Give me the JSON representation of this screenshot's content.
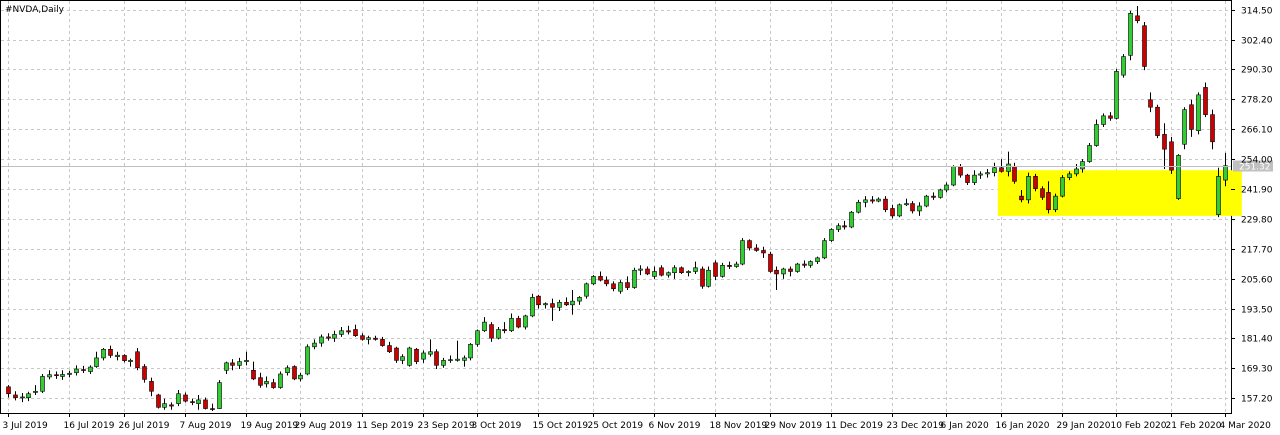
{
  "chart_title": "#NVDA,Daily",
  "current_price_label": "251.32",
  "colors": {
    "bull": "#32cd32",
    "bear": "#cd0000",
    "wick": "#000000",
    "grid": "#c8c8c8",
    "highlight": "#ffff00",
    "price_tag_bg": "#c0c0c0"
  },
  "chart_data": {
    "type": "candlestick",
    "ylim": [
      151.2,
      318.0
    ],
    "grid": true,
    "y_ticks": [
      157.2,
      169.3,
      181.4,
      193.5,
      205.6,
      217.7,
      229.8,
      241.9,
      254.0,
      266.1,
      278.2,
      290.3,
      302.4,
      314.5
    ],
    "y_tick_labels": [
      "157.20",
      "169.30",
      "181.40",
      "193.50",
      "205.60",
      "217.70",
      "229.80",
      "241.90",
      "254.00",
      "266.10",
      "278.20",
      "290.30",
      "302.40",
      "314.50"
    ],
    "x_ticks": [
      {
        "index": 0,
        "label": "3 Jul 2019"
      },
      {
        "index": 9,
        "label": "16 Jul 2019"
      },
      {
        "index": 17,
        "label": "26 Jul 2019"
      },
      {
        "index": 26,
        "label": "7 Aug 2019"
      },
      {
        "index": 35,
        "label": "19 Aug 2019"
      },
      {
        "index": 43,
        "label": "29 Aug 2019"
      },
      {
        "index": 52,
        "label": "11 Sep 2019"
      },
      {
        "index": 61,
        "label": "23 Sep 2019"
      },
      {
        "index": 69,
        "label": "3 Oct 2019"
      },
      {
        "index": 78,
        "label": "15 Oct 2019"
      },
      {
        "index": 86,
        "label": "25 Oct 2019"
      },
      {
        "index": 95,
        "label": "6 Nov 2019"
      },
      {
        "index": 104,
        "label": "18 Nov 2019"
      },
      {
        "index": 112,
        "label": "29 Nov 2019"
      },
      {
        "index": 121,
        "label": "11 Dec 2019"
      },
      {
        "index": 130,
        "label": "23 Dec 2019"
      },
      {
        "index": 138,
        "label": "6 Jan 2020"
      },
      {
        "index": 146,
        "label": "16 Jan 2020"
      },
      {
        "index": 155,
        "label": "29 Jan 2020"
      },
      {
        "index": 163,
        "label": "10 Feb 2020"
      },
      {
        "index": 171,
        "label": "21 Feb 2020"
      },
      {
        "index": 179,
        "label": "4 Mar 2020"
      }
    ],
    "current_price": 251.32,
    "highlight_zone": {
      "start_index": 146,
      "end_index": 181,
      "low": 231.0,
      "high": 249.5
    },
    "candles": [
      {
        "o": 161.8,
        "h": 162.5,
        "l": 157.5,
        "c": 159.0
      },
      {
        "o": 158.5,
        "h": 160.0,
        "l": 156.3,
        "c": 157.4
      },
      {
        "o": 157.4,
        "h": 159.3,
        "l": 155.6,
        "c": 157.7
      },
      {
        "o": 157.4,
        "h": 159.8,
        "l": 156.0,
        "c": 159.0
      },
      {
        "o": 159.5,
        "h": 162.5,
        "l": 158.5,
        "c": 160.0
      },
      {
        "o": 160.0,
        "h": 167.0,
        "l": 159.3,
        "c": 166.0
      },
      {
        "o": 165.8,
        "h": 168.5,
        "l": 164.8,
        "c": 166.7
      },
      {
        "o": 166.7,
        "h": 168.0,
        "l": 165.0,
        "c": 166.5
      },
      {
        "o": 166.0,
        "h": 168.5,
        "l": 164.6,
        "c": 166.8
      },
      {
        "o": 166.8,
        "h": 168.3,
        "l": 165.6,
        "c": 167.3
      },
      {
        "o": 167.5,
        "h": 170.5,
        "l": 166.4,
        "c": 169.0
      },
      {
        "o": 168.8,
        "h": 170.3,
        "l": 167.4,
        "c": 168.5
      },
      {
        "o": 168.0,
        "h": 170.5,
        "l": 167.0,
        "c": 169.8
      },
      {
        "o": 170.0,
        "h": 176.0,
        "l": 169.5,
        "c": 173.5
      },
      {
        "o": 173.5,
        "h": 177.5,
        "l": 172.5,
        "c": 177.0
      },
      {
        "o": 177.0,
        "h": 178.5,
        "l": 173.5,
        "c": 174.5
      },
      {
        "o": 174.0,
        "h": 176.0,
        "l": 172.5,
        "c": 174.6
      },
      {
        "o": 174.5,
        "h": 175.0,
        "l": 171.7,
        "c": 172.4
      },
      {
        "o": 172.0,
        "h": 173.2,
        "l": 170.0,
        "c": 172.5
      },
      {
        "o": 176.0,
        "h": 177.5,
        "l": 168.5,
        "c": 169.5
      },
      {
        "o": 170.0,
        "h": 171.0,
        "l": 163.5,
        "c": 164.8
      },
      {
        "o": 164.0,
        "h": 165.5,
        "l": 158.0,
        "c": 160.0
      },
      {
        "o": 158.5,
        "h": 159.0,
        "l": 153.0,
        "c": 153.5
      },
      {
        "o": 153.5,
        "h": 157.0,
        "l": 152.5,
        "c": 155.0
      },
      {
        "o": 154.5,
        "h": 155.5,
        "l": 152.5,
        "c": 154.0
      },
      {
        "o": 155.0,
        "h": 160.5,
        "l": 154.0,
        "c": 159.0
      },
      {
        "o": 158.5,
        "h": 159.5,
        "l": 155.5,
        "c": 156.0
      },
      {
        "o": 155.8,
        "h": 157.0,
        "l": 154.4,
        "c": 155.5
      },
      {
        "o": 155.0,
        "h": 158.5,
        "l": 152.5,
        "c": 156.5
      },
      {
        "o": 156.5,
        "h": 157.5,
        "l": 152.6,
        "c": 153.0
      },
      {
        "o": 153.0,
        "h": 155.0,
        "l": 152.0,
        "c": 152.9
      },
      {
        "o": 153.0,
        "h": 164.5,
        "l": 152.8,
        "c": 163.5
      },
      {
        "o": 168.5,
        "h": 172.0,
        "l": 167.0,
        "c": 171.5
      },
      {
        "o": 171.5,
        "h": 173.0,
        "l": 168.5,
        "c": 170.5
      },
      {
        "o": 170.5,
        "h": 173.5,
        "l": 169.0,
        "c": 172.0
      },
      {
        "o": 172.0,
        "h": 176.0,
        "l": 170.5,
        "c": 172.5
      },
      {
        "o": 168.5,
        "h": 172.0,
        "l": 164.5,
        "c": 165.0
      },
      {
        "o": 165.5,
        "h": 167.5,
        "l": 161.4,
        "c": 162.4
      },
      {
        "o": 163.0,
        "h": 166.0,
        "l": 161.5,
        "c": 164.0
      },
      {
        "o": 163.5,
        "h": 165.0,
        "l": 161.0,
        "c": 161.5
      },
      {
        "o": 161.5,
        "h": 168.0,
        "l": 161.0,
        "c": 167.0
      },
      {
        "o": 167.5,
        "h": 170.5,
        "l": 166.4,
        "c": 169.5
      },
      {
        "o": 170.0,
        "h": 170.5,
        "l": 164.5,
        "c": 165.0
      },
      {
        "o": 165.0,
        "h": 167.5,
        "l": 164.0,
        "c": 166.5
      },
      {
        "o": 167.0,
        "h": 179.0,
        "l": 166.5,
        "c": 178.0
      },
      {
        "o": 178.0,
        "h": 181.0,
        "l": 177.0,
        "c": 179.5
      },
      {
        "o": 179.5,
        "h": 183.0,
        "l": 178.0,
        "c": 182.0
      },
      {
        "o": 182.0,
        "h": 183.5,
        "l": 180.5,
        "c": 181.5
      },
      {
        "o": 181.5,
        "h": 184.5,
        "l": 180.0,
        "c": 183.0
      },
      {
        "o": 183.0,
        "h": 186.0,
        "l": 182.0,
        "c": 184.5
      },
      {
        "o": 184.5,
        "h": 186.5,
        "l": 183.0,
        "c": 184.0
      },
      {
        "o": 185.0,
        "h": 187.0,
        "l": 182.0,
        "c": 182.5
      },
      {
        "o": 182.5,
        "h": 183.5,
        "l": 180.5,
        "c": 181.0
      },
      {
        "o": 181.0,
        "h": 182.5,
        "l": 179.0,
        "c": 181.7
      },
      {
        "o": 181.5,
        "h": 182.5,
        "l": 180.5,
        "c": 181.0
      },
      {
        "o": 181.0,
        "h": 182.0,
        "l": 178.0,
        "c": 178.5
      },
      {
        "o": 178.5,
        "h": 180.0,
        "l": 175.5,
        "c": 176.0
      },
      {
        "o": 177.5,
        "h": 178.0,
        "l": 171.5,
        "c": 172.5
      },
      {
        "o": 172.5,
        "h": 175.0,
        "l": 171.0,
        "c": 174.0
      },
      {
        "o": 170.5,
        "h": 178.0,
        "l": 170.0,
        "c": 177.5
      },
      {
        "o": 177.0,
        "h": 177.5,
        "l": 171.0,
        "c": 172.0
      },
      {
        "o": 173.0,
        "h": 176.5,
        "l": 171.5,
        "c": 175.5
      },
      {
        "o": 175.0,
        "h": 181.0,
        "l": 174.0,
        "c": 176.0
      },
      {
        "o": 176.0,
        "h": 177.0,
        "l": 169.0,
        "c": 170.5
      },
      {
        "o": 170.5,
        "h": 173.5,
        "l": 169.5,
        "c": 172.5
      },
      {
        "o": 172.5,
        "h": 174.5,
        "l": 171.5,
        "c": 172.8
      },
      {
        "o": 172.5,
        "h": 180.5,
        "l": 172.0,
        "c": 173.0
      },
      {
        "o": 172.5,
        "h": 174.5,
        "l": 170.0,
        "c": 173.5
      },
      {
        "o": 173.5,
        "h": 179.5,
        "l": 172.5,
        "c": 179.0
      },
      {
        "o": 179.0,
        "h": 185.0,
        "l": 178.0,
        "c": 184.5
      },
      {
        "o": 184.5,
        "h": 190.0,
        "l": 184.0,
        "c": 188.0
      },
      {
        "o": 187.0,
        "h": 188.0,
        "l": 180.0,
        "c": 181.5
      },
      {
        "o": 181.5,
        "h": 186.0,
        "l": 181.0,
        "c": 185.0
      },
      {
        "o": 185.0,
        "h": 188.0,
        "l": 183.5,
        "c": 184.5
      },
      {
        "o": 184.5,
        "h": 191.5,
        "l": 184.0,
        "c": 189.5
      },
      {
        "o": 189.5,
        "h": 190.5,
        "l": 185.5,
        "c": 186.0
      },
      {
        "o": 186.0,
        "h": 191.0,
        "l": 185.0,
        "c": 190.5
      },
      {
        "o": 190.5,
        "h": 199.5,
        "l": 190.0,
        "c": 198.0
      },
      {
        "o": 198.5,
        "h": 199.0,
        "l": 193.5,
        "c": 195.0
      },
      {
        "o": 195.0,
        "h": 196.0,
        "l": 193.5,
        "c": 195.5
      },
      {
        "o": 195.5,
        "h": 197.5,
        "l": 188.5,
        "c": 194.0
      },
      {
        "o": 194.0,
        "h": 197.0,
        "l": 192.5,
        "c": 196.0
      },
      {
        "o": 196.0,
        "h": 198.0,
        "l": 194.5,
        "c": 195.0
      },
      {
        "o": 195.0,
        "h": 201.0,
        "l": 191.0,
        "c": 196.5
      },
      {
        "o": 196.5,
        "h": 198.5,
        "l": 195.0,
        "c": 198.0
      },
      {
        "o": 198.5,
        "h": 204.0,
        "l": 197.5,
        "c": 203.5
      },
      {
        "o": 203.5,
        "h": 207.0,
        "l": 203.0,
        "c": 206.5
      },
      {
        "o": 206.5,
        "h": 208.5,
        "l": 204.5,
        "c": 205.0
      },
      {
        "o": 205.0,
        "h": 206.5,
        "l": 202.5,
        "c": 203.5
      },
      {
        "o": 203.5,
        "h": 204.5,
        "l": 200.5,
        "c": 201.5
      },
      {
        "o": 200.5,
        "h": 205.0,
        "l": 199.5,
        "c": 204.0
      },
      {
        "o": 204.0,
        "h": 206.5,
        "l": 201.0,
        "c": 202.0
      },
      {
        "o": 202.0,
        "h": 210.0,
        "l": 201.5,
        "c": 209.0
      },
      {
        "o": 209.0,
        "h": 211.0,
        "l": 207.0,
        "c": 209.5
      },
      {
        "o": 209.5,
        "h": 210.5,
        "l": 207.0,
        "c": 207.5
      },
      {
        "o": 206.5,
        "h": 210.5,
        "l": 205.5,
        "c": 208.5
      },
      {
        "o": 210.0,
        "h": 211.0,
        "l": 206.5,
        "c": 207.0
      },
      {
        "o": 207.0,
        "h": 208.5,
        "l": 206.0,
        "c": 208.0
      },
      {
        "o": 208.0,
        "h": 211.0,
        "l": 205.5,
        "c": 210.0
      },
      {
        "o": 210.0,
        "h": 210.5,
        "l": 207.5,
        "c": 208.0
      },
      {
        "o": 208.0,
        "h": 209.0,
        "l": 206.5,
        "c": 208.5
      },
      {
        "o": 208.5,
        "h": 212.5,
        "l": 207.5,
        "c": 210.0
      },
      {
        "o": 209.5,
        "h": 210.5,
        "l": 201.5,
        "c": 202.5
      },
      {
        "o": 202.5,
        "h": 210.5,
        "l": 202.0,
        "c": 209.0
      },
      {
        "o": 212.0,
        "h": 213.0,
        "l": 205.0,
        "c": 206.5
      },
      {
        "o": 206.5,
        "h": 212.0,
        "l": 206.0,
        "c": 211.0
      },
      {
        "o": 211.0,
        "h": 212.5,
        "l": 209.5,
        "c": 210.5
      },
      {
        "o": 210.5,
        "h": 212.5,
        "l": 210.0,
        "c": 211.5
      },
      {
        "o": 211.5,
        "h": 222.0,
        "l": 211.0,
        "c": 221.0
      },
      {
        "o": 221.0,
        "h": 221.5,
        "l": 217.0,
        "c": 218.0
      },
      {
        "o": 218.0,
        "h": 219.5,
        "l": 216.5,
        "c": 217.0
      },
      {
        "o": 217.0,
        "h": 218.5,
        "l": 214.0,
        "c": 216.0
      },
      {
        "o": 215.5,
        "h": 216.5,
        "l": 208.0,
        "c": 208.5
      },
      {
        "o": 209.0,
        "h": 210.5,
        "l": 201.0,
        "c": 207.5
      },
      {
        "o": 207.5,
        "h": 210.0,
        "l": 205.5,
        "c": 209.5
      },
      {
        "o": 209.5,
        "h": 210.5,
        "l": 206.5,
        "c": 208.5
      },
      {
        "o": 208.5,
        "h": 212.0,
        "l": 208.0,
        "c": 211.5
      },
      {
        "o": 211.5,
        "h": 213.0,
        "l": 210.0,
        "c": 211.0
      },
      {
        "o": 211.0,
        "h": 213.0,
        "l": 210.0,
        "c": 212.5
      },
      {
        "o": 212.5,
        "h": 214.5,
        "l": 211.5,
        "c": 214.0
      },
      {
        "o": 214.0,
        "h": 222.0,
        "l": 213.5,
        "c": 221.0
      },
      {
        "o": 221.0,
        "h": 226.0,
        "l": 220.5,
        "c": 225.5
      },
      {
        "o": 225.5,
        "h": 228.0,
        "l": 224.5,
        "c": 227.0
      },
      {
        "o": 227.0,
        "h": 229.0,
        "l": 225.5,
        "c": 226.5
      },
      {
        "o": 226.5,
        "h": 233.0,
        "l": 226.0,
        "c": 232.5
      },
      {
        "o": 232.5,
        "h": 237.5,
        "l": 232.0,
        "c": 236.5
      },
      {
        "o": 236.5,
        "h": 239.0,
        "l": 234.5,
        "c": 237.5
      },
      {
        "o": 237.5,
        "h": 239.0,
        "l": 236.0,
        "c": 237.0
      },
      {
        "o": 237.0,
        "h": 238.5,
        "l": 236.5,
        "c": 237.8
      },
      {
        "o": 237.8,
        "h": 239.0,
        "l": 232.5,
        "c": 233.5
      },
      {
        "o": 234.0,
        "h": 235.5,
        "l": 230.0,
        "c": 231.0
      },
      {
        "o": 231.0,
        "h": 236.0,
        "l": 230.5,
        "c": 235.5
      },
      {
        "o": 235.5,
        "h": 238.0,
        "l": 235.0,
        "c": 236.0
      },
      {
        "o": 236.0,
        "h": 237.0,
        "l": 232.0,
        "c": 233.0
      },
      {
        "o": 233.0,
        "h": 236.5,
        "l": 231.0,
        "c": 235.0
      },
      {
        "o": 235.0,
        "h": 239.5,
        "l": 234.5,
        "c": 239.0
      },
      {
        "o": 239.0,
        "h": 240.5,
        "l": 237.5,
        "c": 238.5
      },
      {
        "o": 238.5,
        "h": 242.0,
        "l": 238.0,
        "c": 241.5
      },
      {
        "o": 241.5,
        "h": 244.5,
        "l": 240.5,
        "c": 243.5
      },
      {
        "o": 243.5,
        "h": 251.5,
        "l": 243.0,
        "c": 251.0
      },
      {
        "o": 251.0,
        "h": 252.0,
        "l": 246.5,
        "c": 247.5
      },
      {
        "o": 247.5,
        "h": 248.0,
        "l": 243.5,
        "c": 244.5
      },
      {
        "o": 244.5,
        "h": 249.5,
        "l": 243.5,
        "c": 247.5
      },
      {
        "o": 247.5,
        "h": 249.0,
        "l": 246.0,
        "c": 248.0
      },
      {
        "o": 248.0,
        "h": 250.0,
        "l": 246.5,
        "c": 248.5
      },
      {
        "o": 248.5,
        "h": 252.5,
        "l": 247.0,
        "c": 250.5
      },
      {
        "o": 250.5,
        "h": 254.0,
        "l": 248.5,
        "c": 249.0
      },
      {
        "o": 249.0,
        "h": 257.0,
        "l": 247.0,
        "c": 252.0
      },
      {
        "o": 251.0,
        "h": 252.5,
        "l": 244.0,
        "c": 245.0
      },
      {
        "o": 239.0,
        "h": 241.5,
        "l": 236.5,
        "c": 237.5
      },
      {
        "o": 237.5,
        "h": 248.5,
        "l": 236.0,
        "c": 247.0
      },
      {
        "o": 247.0,
        "h": 248.0,
        "l": 241.0,
        "c": 242.0
      },
      {
        "o": 242.0,
        "h": 243.0,
        "l": 237.5,
        "c": 238.5
      },
      {
        "o": 240.5,
        "h": 245.0,
        "l": 232.0,
        "c": 233.5
      },
      {
        "o": 233.5,
        "h": 240.0,
        "l": 232.5,
        "c": 239.0
      },
      {
        "o": 239.0,
        "h": 247.5,
        "l": 238.5,
        "c": 246.5
      },
      {
        "o": 246.5,
        "h": 249.0,
        "l": 245.5,
        "c": 248.0
      },
      {
        "o": 248.0,
        "h": 252.0,
        "l": 247.0,
        "c": 250.0
      },
      {
        "o": 250.0,
        "h": 254.0,
        "l": 248.5,
        "c": 253.0
      },
      {
        "o": 253.0,
        "h": 260.5,
        "l": 252.5,
        "c": 259.5
      },
      {
        "o": 259.5,
        "h": 270.0,
        "l": 259.0,
        "c": 268.0
      },
      {
        "o": 268.0,
        "h": 272.5,
        "l": 267.0,
        "c": 271.5
      },
      {
        "o": 271.5,
        "h": 273.0,
        "l": 269.5,
        "c": 270.5
      },
      {
        "o": 270.5,
        "h": 290.5,
        "l": 270.0,
        "c": 289.5
      },
      {
        "o": 288.0,
        "h": 296.5,
        "l": 287.0,
        "c": 295.5
      },
      {
        "o": 296.0,
        "h": 314.0,
        "l": 294.0,
        "c": 313.0
      },
      {
        "o": 312.0,
        "h": 316.0,
        "l": 309.0,
        "c": 310.0
      },
      {
        "o": 308.0,
        "h": 309.5,
        "l": 290.0,
        "c": 291.5
      },
      {
        "o": 278.0,
        "h": 281.0,
        "l": 273.0,
        "c": 275.0
      },
      {
        "o": 275.0,
        "h": 276.0,
        "l": 262.5,
        "c": 263.5
      },
      {
        "o": 264.0,
        "h": 268.5,
        "l": 250.0,
        "c": 258.0
      },
      {
        "o": 261.0,
        "h": 263.0,
        "l": 248.0,
        "c": 249.5
      },
      {
        "o": 238.0,
        "h": 256.0,
        "l": 237.5,
        "c": 255.5
      },
      {
        "o": 260.0,
        "h": 275.0,
        "l": 258.0,
        "c": 274.0
      },
      {
        "o": 276.0,
        "h": 278.0,
        "l": 263.0,
        "c": 266.0
      },
      {
        "o": 265.5,
        "h": 281.0,
        "l": 264.0,
        "c": 280.0
      },
      {
        "o": 283.0,
        "h": 285.0,
        "l": 271.0,
        "c": 272.0
      },
      {
        "o": 272.0,
        "h": 274.0,
        "l": 258.0,
        "c": 261.0
      },
      {
        "o": 231.5,
        "h": 250.5,
        "l": 230.5,
        "c": 247.0
      },
      {
        "o": 245.5,
        "h": 256.5,
        "l": 243.0,
        "c": 251.3
      }
    ]
  }
}
